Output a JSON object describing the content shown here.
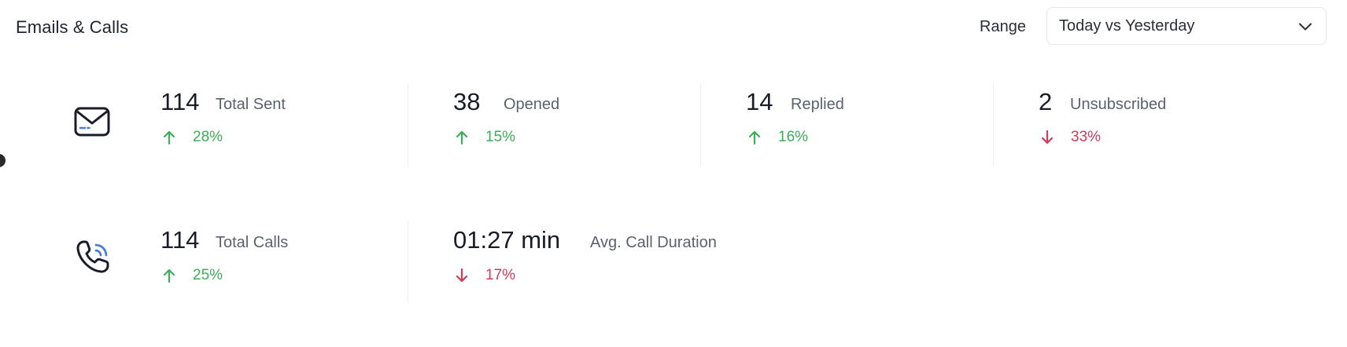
{
  "header": {
    "title": "Emails & Calls",
    "range_label": "Range",
    "range_value": "Today vs Yesterday"
  },
  "icons": {
    "email": "envelope-icon",
    "calls": "phone-ringing-icon",
    "dropdown": "chevron-down-icon",
    "up": "arrow-up-icon",
    "down": "arrow-down-icon"
  },
  "colors": {
    "positive": "#3bae57",
    "negative": "#d23a5a",
    "accent_blue": "#4a7fd4"
  },
  "emails": [
    {
      "value": "114",
      "label": "Total Sent",
      "change": "28%",
      "direction": "up"
    },
    {
      "value": "38",
      "label": "Opened",
      "change": "15%",
      "direction": "up"
    },
    {
      "value": "14",
      "label": "Replied",
      "change": "16%",
      "direction": "up"
    },
    {
      "value": "2",
      "label": "Unsubscribed",
      "change": "33%",
      "direction": "down"
    }
  ],
  "calls": [
    {
      "value": "114",
      "label": "Total Calls",
      "change": "25%",
      "direction": "up"
    },
    {
      "value": "01:27 min",
      "label": "Avg. Call Duration",
      "change": "17%",
      "direction": "down"
    }
  ]
}
